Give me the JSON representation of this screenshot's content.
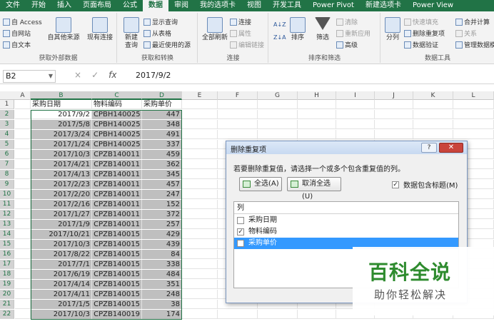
{
  "ribbon_tabs": [
    "文件",
    "开始",
    "插入",
    "页面布局",
    "公式",
    "数据",
    "审阅",
    "视图",
    "我的选项卡",
    "视图",
    "开发工具",
    "Power Pivot",
    "新建选项卡",
    "Power View"
  ],
  "active_tab_index": 5,
  "ribbon_groups": {
    "external": {
      "label": "获取外部数据",
      "access": "自 Access",
      "web": "自网站",
      "text": "自文本",
      "other": "自其他来源",
      "existing": "现有连接"
    },
    "transform": {
      "label": "获取和转换",
      "new_query": "新建\n查询",
      "show_query": "显示查询",
      "from_table": "从表格",
      "recent": "最近使用的源"
    },
    "connections": {
      "label": "连接",
      "refresh_all": "全部刷新",
      "connections": "连接",
      "properties": "属性",
      "edit_links": "编辑链接"
    },
    "sort_filter": {
      "label": "排序和筛选",
      "sort": "排序",
      "filter": "筛选",
      "clear": "清除",
      "reapply": "重新应用",
      "advanced": "高级"
    },
    "data_tools": {
      "label": "数据工具",
      "split": "分列",
      "flash_fill": "快速填充",
      "remove_dup": "删除重复项",
      "validation": "数据验证",
      "consolidate": "合并计算",
      "relations": "关系",
      "data_model": "管理数据模"
    }
  },
  "formula_bar": {
    "name_box": "B2",
    "formula": "2017/9/2",
    "cancel_icon": "×",
    "enter_icon": "✓",
    "fx": "fx"
  },
  "grid": {
    "columns": [
      "A",
      "B",
      "C",
      "D",
      "E",
      "F",
      "G",
      "H",
      "I",
      "J",
      "K",
      "L"
    ],
    "headers": [
      "采购日期",
      "物料编码",
      "采购单价"
    ],
    "rows": [
      [
        "2017/9/2",
        "CPBH140025",
        "447"
      ],
      [
        "2017/5/8",
        "CPBH140025",
        "348"
      ],
      [
        "2017/3/24",
        "CPBH140025",
        "491"
      ],
      [
        "2017/1/24",
        "CPBH140025",
        "337"
      ],
      [
        "2017/10/3",
        "CPZB140011",
        "459"
      ],
      [
        "2017/4/21",
        "CPZB140011",
        "362"
      ],
      [
        "2017/4/13",
        "CPZB140011",
        "345"
      ],
      [
        "2017/2/23",
        "CPZB140011",
        "457"
      ],
      [
        "2017/2/20",
        "CPZB140011",
        "247"
      ],
      [
        "2017/2/16",
        "CPZB140011",
        "152"
      ],
      [
        "2017/1/27",
        "CPZB140011",
        "372"
      ],
      [
        "2017/1/9",
        "CPZB140011",
        "257"
      ],
      [
        "2017/10/21",
        "CPZB140015",
        "429"
      ],
      [
        "2017/10/3",
        "CPZB140015",
        "439"
      ],
      [
        "2017/8/22",
        "CPZB140015",
        "84"
      ],
      [
        "2017/7/1",
        "CPZB140015",
        "338"
      ],
      [
        "2017/6/19",
        "CPZB140015",
        "484"
      ],
      [
        "2017/4/14",
        "CPZB140015",
        "351"
      ],
      [
        "2017/4/11",
        "CPZB140015",
        "248"
      ],
      [
        "2017/1/5",
        "CPZB140015",
        "38"
      ],
      [
        "2017/10/3",
        "CPZB140019",
        "174"
      ]
    ]
  },
  "dialog": {
    "title": "删除重复项",
    "help": "?",
    "close": "✕",
    "instruction": "若要删除重复值，请选择一个或多个包含重复值的列。",
    "select_all": "全选(A)",
    "unselect_all": "取消全选(U)",
    "has_headers_label": "数据包含标题(M)",
    "list_header": "列",
    "columns": [
      {
        "label": "采购日期",
        "checked": false
      },
      {
        "label": "物料编码",
        "checked": true
      },
      {
        "label": "采购单价",
        "checked": false
      }
    ]
  },
  "watermark": {
    "title": "百科全说",
    "subtitle": "助你轻松解决"
  },
  "colors": {
    "excel_green": "#217346",
    "selection_blue": "#3399ff",
    "watermark_green": "#2e8b2e"
  }
}
